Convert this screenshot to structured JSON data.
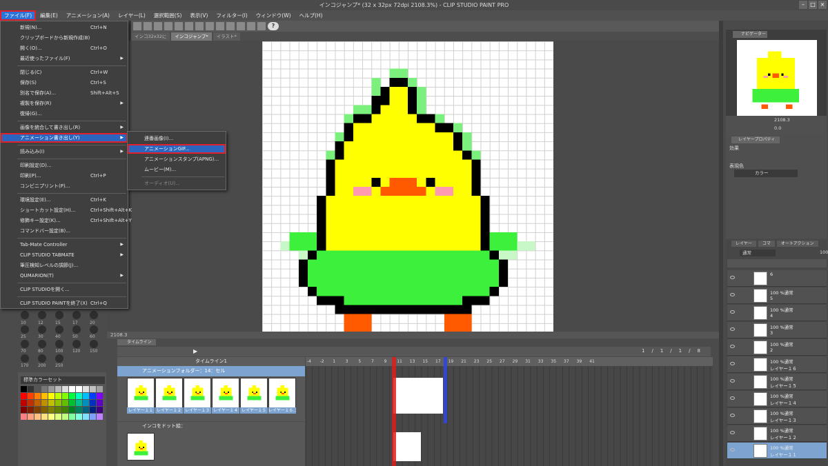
{
  "title": "インコジャンプ* (32 x 32px 72dpi 2108.3%) - CLIP STUDIO PAINT PRO",
  "window_buttons": [
    "–",
    "□",
    "×"
  ],
  "menubar": [
    {
      "label": "ファイル(F)",
      "active": true
    },
    {
      "label": "編集(E)"
    },
    {
      "label": "アニメーション(A)"
    },
    {
      "label": "レイヤー(L)"
    },
    {
      "label": "選択範囲(S)"
    },
    {
      "label": "表示(V)"
    },
    {
      "label": "フィルター(I)"
    },
    {
      "label": "ウィンドウ(W)"
    },
    {
      "label": "ヘルプ(H)"
    }
  ],
  "file_menu": [
    {
      "label": "新規(N)...",
      "shortcut": "Ctrl+N"
    },
    {
      "label": "クリップボードから新規作成(B)"
    },
    {
      "label": "開く(O)...",
      "shortcut": "Ctrl+O"
    },
    {
      "label": "最近使ったファイル(F)",
      "arrow": "▶"
    },
    {
      "sep": true
    },
    {
      "label": "閉じる(C)",
      "shortcut": "Ctrl+W"
    },
    {
      "label": "保存(S)",
      "shortcut": "Ctrl+S"
    },
    {
      "label": "別名で保存(A)...",
      "shortcut": "Shift+Alt+S"
    },
    {
      "label": "複製を保存(R)",
      "arrow": "▶"
    },
    {
      "label": "復帰(G)..."
    },
    {
      "sep": true
    },
    {
      "label": "画像を統合して書き出し(R)",
      "arrow": "▶"
    },
    {
      "label": "アニメーション書き出し(Y)",
      "arrow": "▶",
      "highlighted": true
    },
    {
      "sep": true
    },
    {
      "label": "読み込み(I)",
      "arrow": "▶"
    },
    {
      "sep": true
    },
    {
      "label": "印刷設定(D)..."
    },
    {
      "label": "印刷(P)...",
      "shortcut": "Ctrl+P"
    },
    {
      "label": "コンビニプリント(P)..."
    },
    {
      "sep": true
    },
    {
      "label": "環境設定(E)...",
      "shortcut": "Ctrl+K"
    },
    {
      "label": "ショートカット設定(H)...",
      "shortcut": "Ctrl+Shift+Alt+K"
    },
    {
      "label": "修飾キー設定(K)...",
      "shortcut": "Ctrl+Shift+Alt+Y"
    },
    {
      "label": "コマンドバー設定(B)..."
    },
    {
      "sep": true
    },
    {
      "label": "Tab-Mate Controller",
      "arrow": "▶"
    },
    {
      "label": "CLIP STUDIO TABMATE",
      "arrow": "▶"
    },
    {
      "label": "筆圧検知レベルの調節(J)..."
    },
    {
      "label": "QUMARION(T)",
      "arrow": "▶"
    },
    {
      "sep": true
    },
    {
      "label": "CLIP STUDIOを開く..."
    },
    {
      "sep": true
    },
    {
      "label": "CLIP STUDIO PAINTを終了(X)",
      "shortcut": "Ctrl+Q"
    }
  ],
  "submenu": [
    {
      "label": "連番画像(I)..."
    },
    {
      "label": "アニメーションGIF...",
      "highlighted": true
    },
    {
      "label": "アニメーションスタンプ(APNG)..."
    },
    {
      "label": "ムービー(M)..."
    },
    {
      "sep": true
    },
    {
      "label": "オーディオ(U)...",
      "disabled": true
    }
  ],
  "doc_tabs": [
    {
      "label": "インコ32x32に"
    },
    {
      "label": "インコジャンプ*",
      "active": true
    },
    {
      "label": "イラスト*"
    }
  ],
  "zoom_label": "2108.3",
  "brush_sizes": [
    "10",
    "12",
    "15",
    "17",
    "20",
    "25",
    "30",
    "40",
    "50",
    "60",
    "70",
    "80",
    "100",
    "120",
    "150",
    "170",
    "200",
    "250"
  ],
  "color_set": {
    "name": "標準カラーセット"
  },
  "timeline": {
    "tab": "タイムライン",
    "name": "タイムライン1",
    "ruler": [
      "-4",
      "-2",
      "1",
      "3",
      "5",
      "7",
      "9",
      "11",
      "13",
      "15",
      "17",
      "19",
      "21",
      "23",
      "25",
      "27",
      "29",
      "31",
      "33",
      "35",
      "37",
      "39",
      "41"
    ],
    "frame_counter": [
      "1",
      "/",
      "1",
      "/",
      "1",
      "/",
      "8"
    ],
    "folder": "アニメーションフォルダー：14：セル",
    "cels": [
      "レイヤー１１",
      "レイヤー１２",
      "レイヤー１３",
      "レイヤー１４",
      "レイヤー１５",
      "レイヤー１６.２"
    ],
    "track2": "インコをドット絵："
  },
  "navigator": {
    "tab": "ナビゲーター",
    "zoom": "2108.3",
    "rotate": "0.0"
  },
  "layer_property": {
    "tab": "レイヤープロパティ",
    "effect": "効果",
    "display_color": "表現色",
    "color_mode": "カラー"
  },
  "layer_panel": {
    "tabs": [
      "レイヤー",
      "コマ",
      "オートアクション"
    ],
    "blend": "通常",
    "opacity": "100",
    "layers": [
      {
        "pct": "6",
        "name": ""
      },
      {
        "pct": "100 %通常",
        "name": "5"
      },
      {
        "pct": "100 %通常",
        "name": "4"
      },
      {
        "pct": "100 %通常",
        "name": "3"
      },
      {
        "pct": "100 %通常",
        "name": "2"
      },
      {
        "pct": "100 %通常",
        "name": "レイヤー１６"
      },
      {
        "pct": "100 %通常",
        "name": "レイヤー１５"
      },
      {
        "pct": "100 %通常",
        "name": "レイヤー１４"
      },
      {
        "pct": "100 %通常",
        "name": "レイヤー１３"
      },
      {
        "pct": "100 %通常",
        "name": "レイヤー１２"
      },
      {
        "pct": "100 %通常",
        "name": "レイヤー１１",
        "selected": true
      }
    ]
  },
  "colors": {
    "accent": "#2a66c0",
    "highlight_border": "#e0202a",
    "chick_yellow": "#ffff00",
    "chick_green": "#3cf03c",
    "beak": "#ff5a00"
  }
}
